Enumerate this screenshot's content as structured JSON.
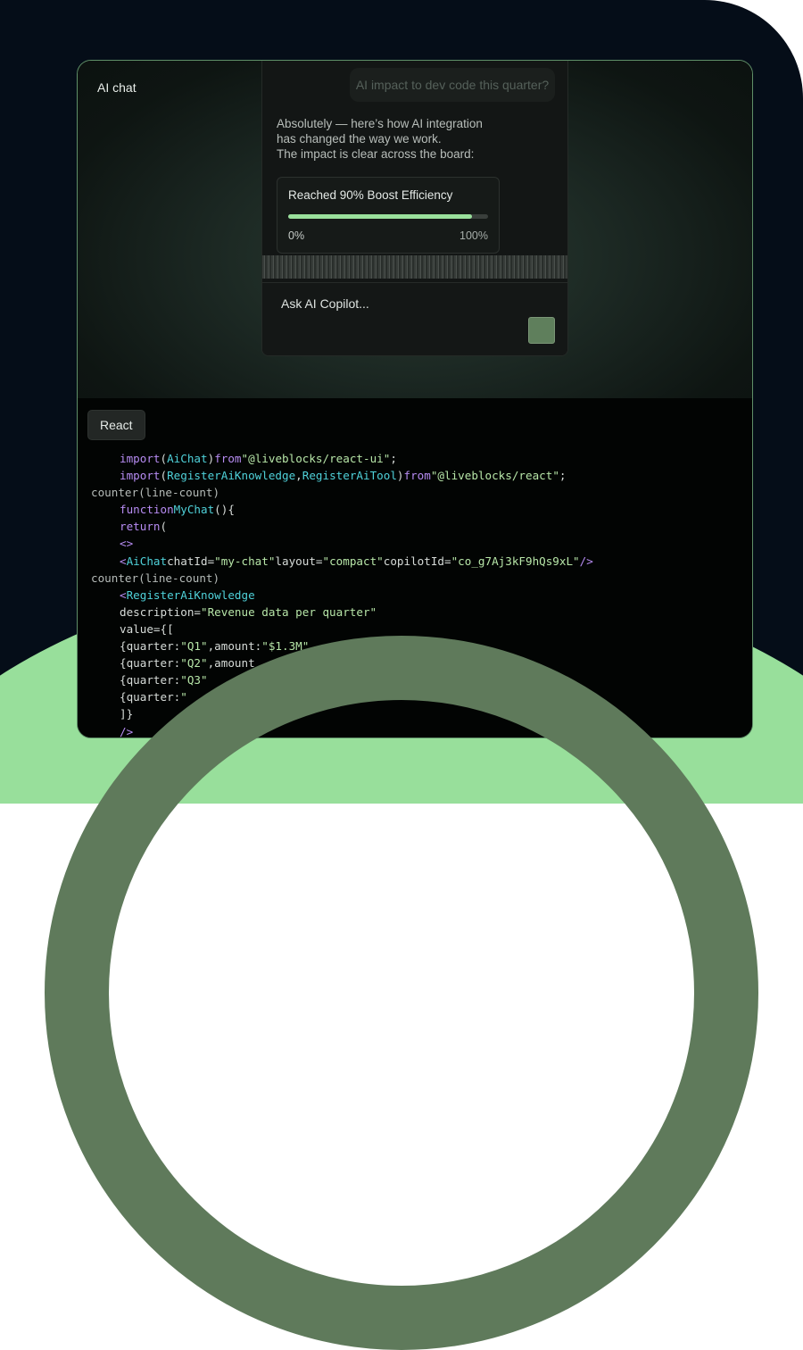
{
  "chat": {
    "title": "AI chat",
    "user_message": "AI impact to dev code this quarter?",
    "reply_lines": [
      "Absolutely — here’s how AI integration",
      "has changed the way we work.",
      "The impact is clear across the board:"
    ],
    "progress": {
      "label": "Reached 90% Boost Efficiency",
      "value_percent": 92,
      "min_label": "0%",
      "max_label": "100%"
    },
    "composer_placeholder": "Ask AI Copilot...",
    "send_icon": "send-icon"
  },
  "code": {
    "tab": "React",
    "lines": [
      {
        "indent": true,
        "tokens": [
          [
            "kw",
            "import"
          ],
          [
            "pl",
            "("
          ],
          [
            "tag",
            "AiChat"
          ],
          [
            "pl",
            ")"
          ],
          [
            "kw",
            "from"
          ],
          [
            "str",
            "\"@liveblocks/react-ui\""
          ],
          [
            "pl",
            ";"
          ]
        ]
      },
      {
        "indent": true,
        "tokens": [
          [
            "kw",
            "import"
          ],
          [
            "pl",
            "("
          ],
          [
            "tag",
            "RegisterAiKnowledge"
          ],
          [
            "pl",
            ","
          ],
          [
            "tag",
            "RegisterAiTool"
          ],
          [
            "pl",
            ")"
          ],
          [
            "kw",
            "from"
          ],
          [
            "str",
            "\"@liveblocks/react\""
          ],
          [
            "pl",
            ";"
          ]
        ]
      },
      {
        "indent": false,
        "tokens": [
          [
            "cnt",
            "counter(line-count)"
          ]
        ]
      },
      {
        "indent": true,
        "tokens": [
          [
            "kw",
            "function"
          ],
          [
            "tag",
            "MyChat"
          ],
          [
            "pl",
            "(){"
          ]
        ]
      },
      {
        "indent": true,
        "tokens": [
          [
            "kw",
            "return"
          ],
          [
            "pl",
            "("
          ]
        ]
      },
      {
        "indent": true,
        "tokens": [
          [
            "kw",
            "<>"
          ]
        ]
      },
      {
        "indent": true,
        "tokens": [
          [
            "kw",
            "<"
          ],
          [
            "tag",
            "AiChat"
          ],
          [
            "pl",
            "chatId="
          ],
          [
            "str",
            "\"my-chat\""
          ],
          [
            "pl",
            "layout="
          ],
          [
            "str",
            "\"compact\""
          ],
          [
            "pl",
            "copilotId="
          ],
          [
            "str",
            "\"co_g7Aj3kF9hQs9xL\""
          ],
          [
            "kw",
            "/>"
          ]
        ]
      },
      {
        "indent": false,
        "tokens": [
          [
            "cnt",
            "counter(line-count)"
          ]
        ]
      },
      {
        "indent": true,
        "tokens": [
          [
            "kw",
            "<"
          ],
          [
            "tag",
            "RegisterAiKnowledge"
          ]
        ]
      },
      {
        "indent": true,
        "tokens": [
          [
            "pl",
            "description="
          ],
          [
            "str",
            "\"Revenue data per quarter\""
          ]
        ]
      },
      {
        "indent": true,
        "tokens": [
          [
            "pl",
            "value={["
          ]
        ]
      },
      {
        "indent": true,
        "tokens": [
          [
            "pl",
            "{quarter:"
          ],
          [
            "str",
            "\"Q1\""
          ],
          [
            "pl",
            ",amount:"
          ],
          [
            "str",
            "\"$1.3M\""
          ]
        ]
      },
      {
        "indent": true,
        "tokens": [
          [
            "pl",
            "{quarter:"
          ],
          [
            "str",
            "\"Q2\""
          ],
          [
            "pl",
            ",amount"
          ]
        ]
      },
      {
        "indent": true,
        "tokens": [
          [
            "pl",
            "{quarter:"
          ],
          [
            "str",
            "\"Q3\""
          ]
        ]
      },
      {
        "indent": true,
        "tokens": [
          [
            "pl",
            "{quarter:"
          ],
          [
            "str",
            "\""
          ]
        ]
      },
      {
        "indent": true,
        "tokens": [
          [
            "pl",
            "]}"
          ]
        ]
      },
      {
        "indent": true,
        "tokens": [
          [
            "kw",
            "/>"
          ]
        ]
      }
    ]
  }
}
